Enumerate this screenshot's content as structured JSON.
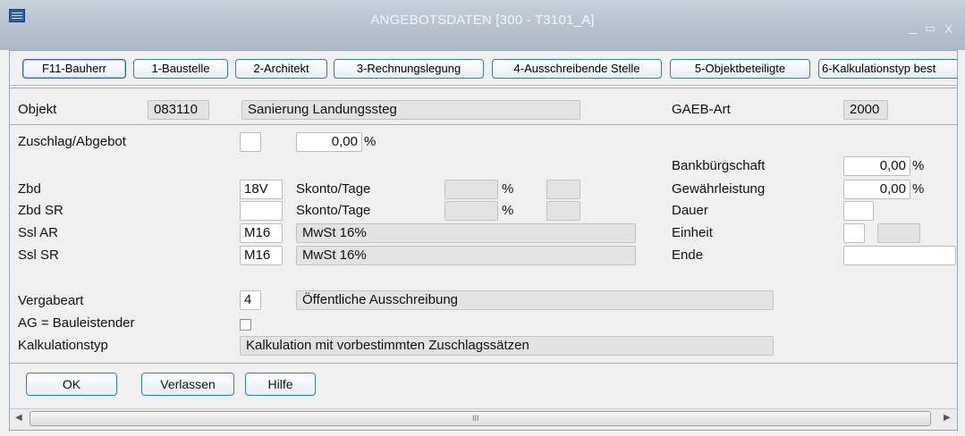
{
  "window": {
    "title": "ANGEBOTSDATEN  [300 - T3101_A]",
    "app_icon": "table-icon",
    "controls": [
      "_",
      "▭",
      "X"
    ]
  },
  "tabs": [
    {
      "label": "F11-Bauherr"
    },
    {
      "label": "1-Baustelle"
    },
    {
      "label": "2-Architekt"
    },
    {
      "label": "3-Rechnungslegung"
    },
    {
      "label": "4-Ausschreibende Stelle"
    },
    {
      "label": "5-Objektbeteiligte"
    },
    {
      "label": "6-Kalkulationstyp best"
    }
  ],
  "header": {
    "objekt_label": "Objekt",
    "objekt_nr": "083110",
    "objekt_name": "Sanierung Landungssteg",
    "gaeb_label": "GAEB-Art",
    "gaeb_value": "2000"
  },
  "form": {
    "zuschlag_label": "Zuschlag/Abgebot",
    "zuschlag_code": "",
    "zuschlag_value": "0,00",
    "zuschlag_unit": "%",
    "zbd_label": "Zbd",
    "zbd_value": "18V",
    "zbd_sr_label": "Zbd SR",
    "zbd_sr_value": "",
    "skonto1_label": "Skonto/Tage",
    "skonto1_pct_unit": "%",
    "skonto2_label": "Skonto/Tage",
    "skonto2_pct_unit": "%",
    "ssl_ar_label": "Ssl AR",
    "ssl_ar_code": "M16",
    "ssl_ar_text": "MwSt 16%",
    "ssl_sr_label": "Ssl SR",
    "ssl_sr_code": "M16",
    "ssl_sr_text": "MwSt 16%",
    "bankbuergschaft_label": "Bankbürgschaft",
    "bankbuergschaft_value": "0,00",
    "bankbuergschaft_unit": "%",
    "gewaehrleistung_label": "Gewährleistung",
    "gewaehrleistung_value": "0,00",
    "gewaehrleistung_unit": "%",
    "dauer_label": "Dauer",
    "dauer_value": "",
    "einheit_label": "Einheit",
    "einheit_value": "",
    "ende_label": "Ende",
    "ende_value": "",
    "vergabeart_label": "Vergabeart",
    "vergabeart_code": "4",
    "vergabeart_text": "Öffentliche Ausschreibung",
    "ag_label": "AG = Bauleistender",
    "ag_checked": false,
    "kalkulationstyp_label": "Kalkulationstyp",
    "kalkulationstyp_text": "Kalkulation mit vorbestimmten Zuschlagssätzen"
  },
  "buttons": {
    "ok": "OK",
    "verlassen": "Verlassen",
    "hilfe": "Hilfe"
  },
  "scrollbar": {
    "grip": "III",
    "left_arrow": "◀",
    "right_arrow": "▶"
  }
}
